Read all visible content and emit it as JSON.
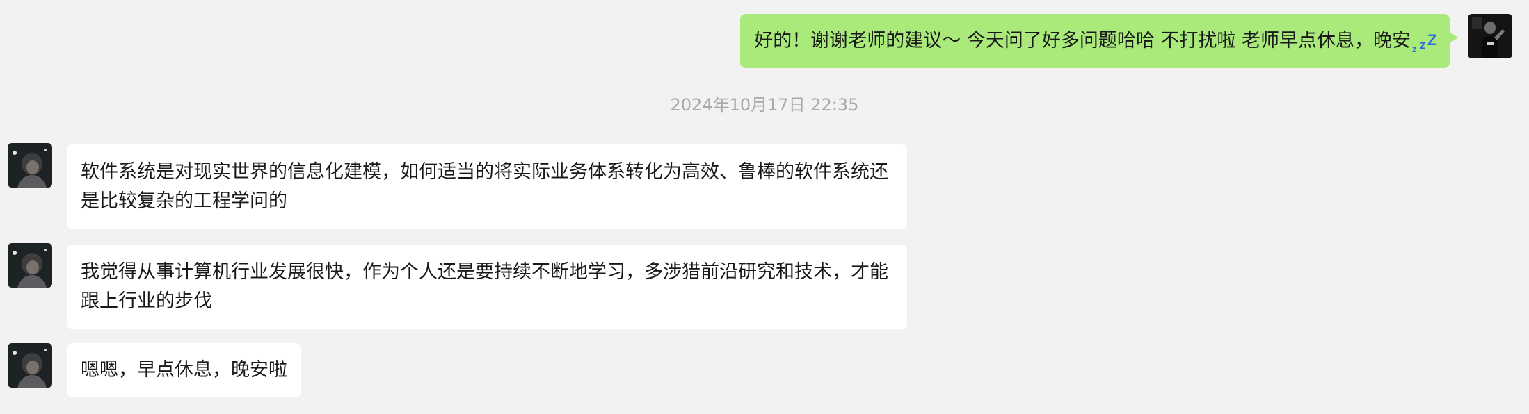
{
  "messages": [
    {
      "direction": "outgoing",
      "text": "好的！谢谢老师的建议～ 今天问了好多问题哈哈 不打扰啦 老师早点休息，晚安",
      "emoji": "sleeping-zzz-icon"
    },
    {
      "direction": "incoming",
      "text": "软件系统是对现实世界的信息化建模，如何适当的将实际业务体系转化为高效、鲁棒的软件系统还是比较复杂的工程学问的"
    },
    {
      "direction": "incoming",
      "text": "我觉得从事计算机行业发展很快，作为个人还是要持续不断地学习，多涉猎前沿研究和技术，才能跟上行业的步伐"
    },
    {
      "direction": "incoming",
      "text": "嗯嗯，早点休息，晚安啦"
    }
  ],
  "timestamp": "2024年10月17日 22:35",
  "colors": {
    "background": "#f2f2f2",
    "outgoing_bubble": "#a9ea7a",
    "incoming_bubble": "#ffffff",
    "timestamp_text": "#a9a9a9",
    "zzz": "#2f6de1"
  }
}
